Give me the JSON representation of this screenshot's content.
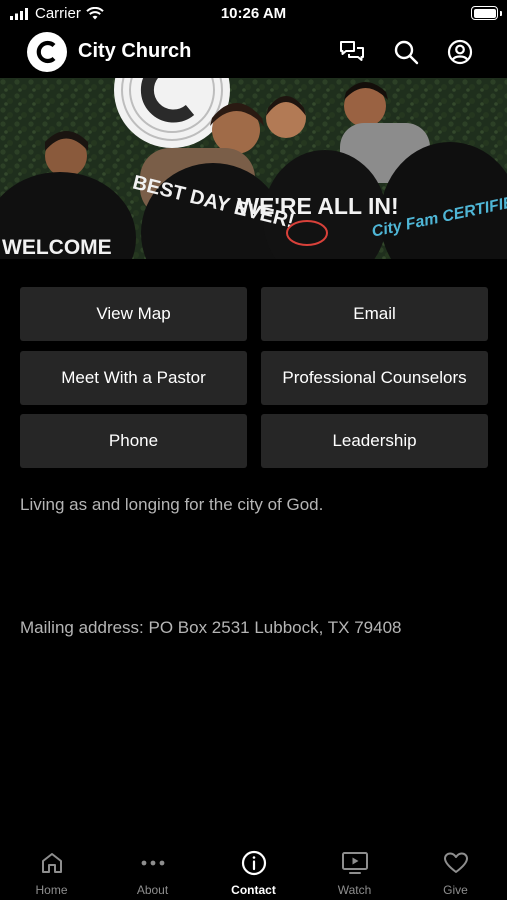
{
  "status_bar": {
    "carrier": "Carrier",
    "time": "10:26 AM"
  },
  "header": {
    "title": "City Church",
    "icons": [
      "chat-icon",
      "search-icon",
      "account-icon"
    ]
  },
  "hero": {
    "signs": [
      "WELCOME",
      "BEST DAY EVER!",
      "WE'RE ALL IN!",
      "City Fam CERTIFIED!"
    ]
  },
  "buttons": [
    {
      "label": "View Map"
    },
    {
      "label": "Email"
    },
    {
      "label": "Meet With a Pastor"
    },
    {
      "label": "Professional Counselors"
    },
    {
      "label": "Phone"
    },
    {
      "label": "Leadership"
    }
  ],
  "tagline": "Living as and longing for the city of God.",
  "mailing": "Mailing address: PO Box 2531 Lubbock, TX 79408",
  "tabs": [
    {
      "label": "Home",
      "icon": "home-icon"
    },
    {
      "label": "About",
      "icon": "more-icon"
    },
    {
      "label": "Contact",
      "icon": "info-icon",
      "active": true
    },
    {
      "label": "Watch",
      "icon": "tv-play-icon"
    },
    {
      "label": "Give",
      "icon": "heart-icon"
    }
  ],
  "colors": {
    "background": "#000000",
    "button": "#262626",
    "muted_text": "#b5b5b5",
    "tab_inactive": "#8e8e8e"
  }
}
